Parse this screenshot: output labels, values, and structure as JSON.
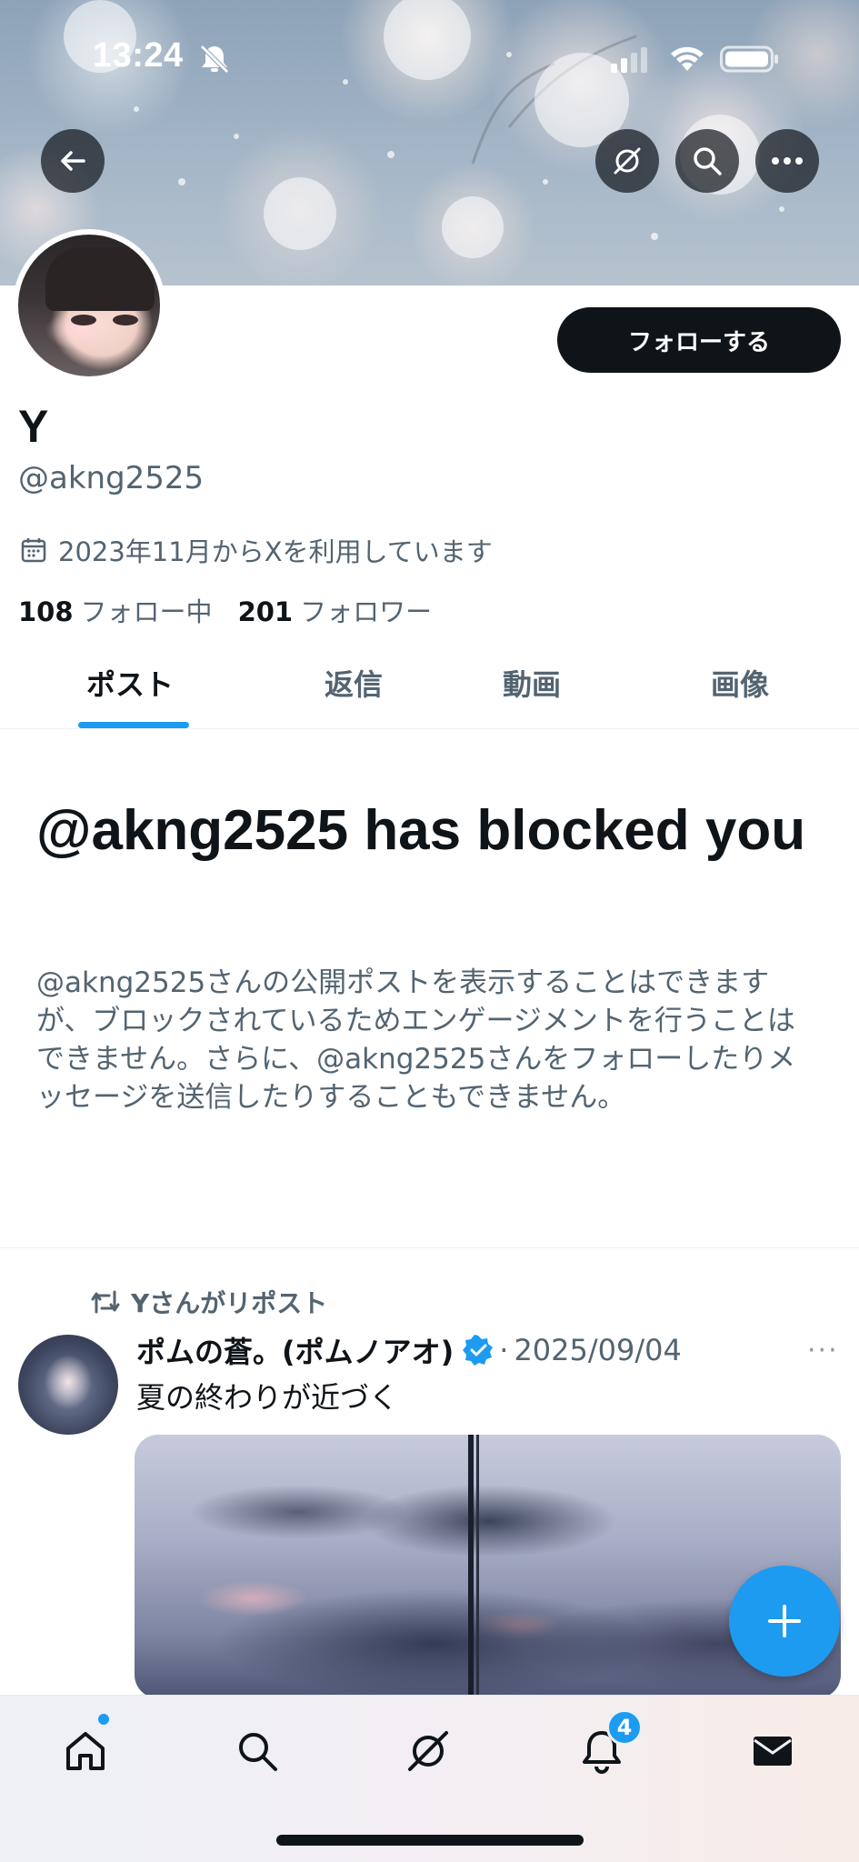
{
  "status_bar": {
    "time": "13:24"
  },
  "header": {
    "back_icon": "arrow-left-icon",
    "grok_icon": "grok-icon",
    "search_icon": "search-icon",
    "more_icon": "more-horizontal-icon"
  },
  "profile": {
    "name": "Y",
    "handle": "@akng2525",
    "joined": "2023年11月からXを利用しています",
    "following_count": "108",
    "following_label": "フォロー中",
    "followers_count": "201",
    "followers_label": "フォロワー",
    "follow_button": "フォローする"
  },
  "tabs": [
    {
      "label": "ポスト",
      "active": true
    },
    {
      "label": "返信",
      "active": false
    },
    {
      "label": "動画",
      "active": false
    },
    {
      "label": "画像",
      "active": false
    }
  ],
  "blocked": {
    "title": "@akng2525 has blocked you",
    "description": "@akng2525さんの公開ポストを表示することはできますが、ブロックされているためエンゲージメントを行うことはできません。さらに、@akng2525さんをフォローしたりメッセージを送信したりすることもできません。"
  },
  "post": {
    "repost_label": "Yさんがリポスト",
    "author": "ポムの蒼。(ポムノアオ)",
    "separator": "·",
    "date": "2025/09/04",
    "more": "···",
    "text": "夏の終わりが近づく"
  },
  "fab": {
    "icon": "plus-icon"
  },
  "bottom_nav": {
    "items": [
      "home-icon",
      "search-icon",
      "grok-icon",
      "bell-icon",
      "mail-icon"
    ],
    "notification_count": "4"
  },
  "colors": {
    "accent": "#1d9bf0",
    "text": "#0f1419",
    "secondary": "#536471"
  }
}
